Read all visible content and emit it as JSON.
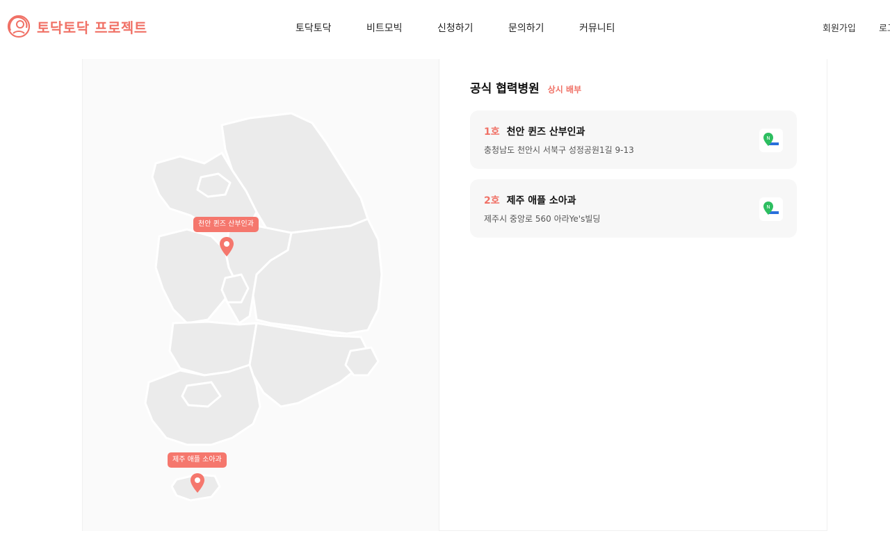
{
  "header": {
    "logo_text": "토닥토닥 프로젝트",
    "nav": [
      "토닥토닥",
      "비트모빅",
      "신청하기",
      "문의하기",
      "커뮤니티"
    ],
    "signup": "회원가입",
    "login": "로그"
  },
  "map": {
    "pins": [
      {
        "label": "천안 퀸즈 산부인과"
      },
      {
        "label": "제주 애플 소아과"
      }
    ]
  },
  "list": {
    "title": "공식 협력병원",
    "badge": "상시 배부",
    "hospitals": [
      {
        "number": "1호",
        "name": "천안 퀸즈 산부인과",
        "address": "충청남도 천안시 서북구 성정공원1길 9-13",
        "map_icon": "naver-map-icon"
      },
      {
        "number": "2호",
        "name": "제주 애플 소아과",
        "address": "제주시 중앙로 560 아라Ye's빌딩",
        "map_icon": "naver-map-icon"
      }
    ]
  },
  "colors": {
    "accent": "#f07166",
    "pin": "#f5776d",
    "card_bg": "#f7f7f7",
    "map_fill": "#ebebeb"
  }
}
